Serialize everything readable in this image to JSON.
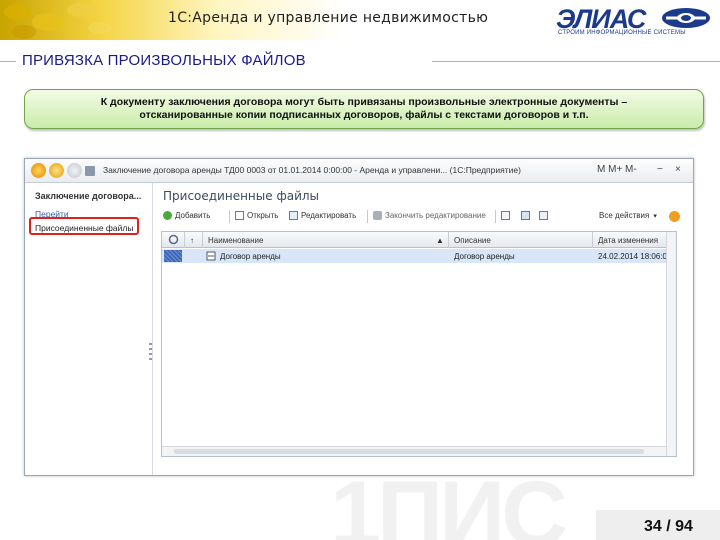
{
  "header": {
    "app_title": "1С:Аренда и управление недвижимостью",
    "logo_word": "ЭЛИАС",
    "logo_tagline": "СТРОИМ ИНФОРМАЦИОННЫЕ СИСТЕМЫ"
  },
  "section_title": "ПРИВЯЗКА ПРОИЗВОЛЬНЫХ ФАЙЛОВ",
  "callout": {
    "line1": "К документу заключения договора могут быть привязаны произвольные электронные документы –",
    "line2": "отсканированные копии подписанных договоров, файлы с текстами договоров и т.п."
  },
  "window": {
    "title": "Заключение договора аренды ТД00 0003 от 01.01.2014 0:00:00 - Аренда и управлени... (1С:Предприятие)",
    "title_right": "M  M+  M-",
    "left_pane": {
      "header": "Заключение договора...",
      "items": [
        "Перейти",
        "Присоединенные файлы"
      ]
    },
    "content": {
      "title": "Присоединенные файлы",
      "toolbar": {
        "add": "Добавить",
        "open": "Открыть",
        "edit": "Редактировать",
        "finish_edit": "Закончить редактирование",
        "all_actions": "Все действия"
      },
      "columns": [
        "Наименование",
        "Описание",
        "Дата изменения"
      ],
      "rows": [
        {
          "name": "Договор аренды",
          "description": "Договор аренды",
          "date": "24.02.2014 18:06:0"
        }
      ]
    }
  },
  "watermark": "1ПИС",
  "page_indicator": "34 / 94",
  "colors": {
    "accent_title": "#1a1a8a",
    "logo_blue": "#1b3a8c",
    "callout_green": "#c9ecaa",
    "highlight_red": "#e0201b",
    "selection_blue": "#d8e6f8"
  }
}
